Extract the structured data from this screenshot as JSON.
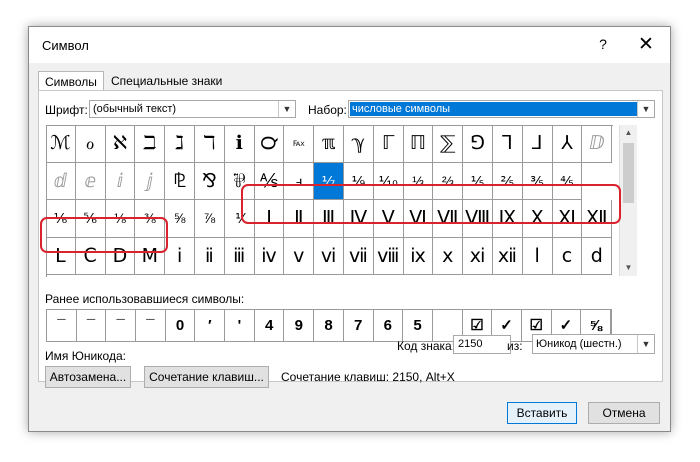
{
  "window": {
    "title": "Символ",
    "help": "?",
    "close": "✕"
  },
  "tabs": [
    {
      "label": "Символы"
    },
    {
      "label": "Специальные знаки"
    }
  ],
  "font_label": "Шрифт:",
  "font_value": "(обычный текст)",
  "subset_label": "Набор:",
  "subset_value": "числовые символы",
  "grid_rows": [
    [
      "ℳ",
      "ℴ",
      "ℵ",
      "ℶ",
      "ℷ",
      "ℸ",
      "ℹ",
      "℺",
      "℻",
      "ℼ",
      "ℽ",
      "ℾ",
      "ℿ",
      "⅀",
      "⅁",
      "⅂",
      "⅃",
      "⅄",
      "ⅅ"
    ],
    [
      "ⅆ",
      "ⅇ",
      "ⅈ",
      "ⅉ",
      "⅊",
      "⅋",
      "⅌",
      "⅍",
      "ⅎ",
      "⅐",
      "⅑",
      "⅒",
      "⅓",
      "⅔",
      "⅕",
      "⅖",
      "⅗",
      "⅘"
    ],
    [
      "⅙",
      "⅚",
      "⅛",
      "⅜",
      "⅝",
      "⅞",
      "⅟",
      "Ⅰ",
      "Ⅱ",
      "Ⅲ",
      "Ⅳ",
      "Ⅴ",
      "Ⅵ",
      "Ⅶ",
      "Ⅷ",
      "Ⅸ",
      "Ⅹ",
      "Ⅺ",
      "Ⅻ"
    ],
    [
      "Ⅼ",
      "Ⅽ",
      "Ⅾ",
      "Ⅿ",
      "ⅰ",
      "ⅱ",
      "ⅲ",
      "ⅳ",
      "ⅴ",
      "ⅵ",
      "ⅶ",
      "ⅷ",
      "ⅸ",
      "ⅹ",
      "ⅺ",
      "ⅻ",
      "ⅼ",
      "ⅽ",
      "ⅾ"
    ]
  ],
  "recent_label": "Ранее использовавшиеся символы:",
  "recent_symbols": [
    "¯",
    "¯",
    "¯",
    "¯",
    "0",
    "′",
    "'",
    "4",
    "9",
    "8",
    "7",
    "6",
    "5",
    "",
    "☑",
    "✓",
    "☑",
    "✓",
    "⅝"
  ],
  "unicode_name_label": "Имя Юникода:",
  "char_code_label": "Код знака:",
  "char_code_value": "2150",
  "from_label": "из:",
  "from_value": "Юникод (шестн.)",
  "autocorrect_button": "Автозамена...",
  "shortcut_button": "Сочетание клавиш...",
  "shortcut_text": "Сочетание клавиш: 2150, Alt+X",
  "insert_button": "Вставить",
  "cancel_button": "Отмена",
  "highlight_color": "#d9232d",
  "accent": "#0078d7"
}
